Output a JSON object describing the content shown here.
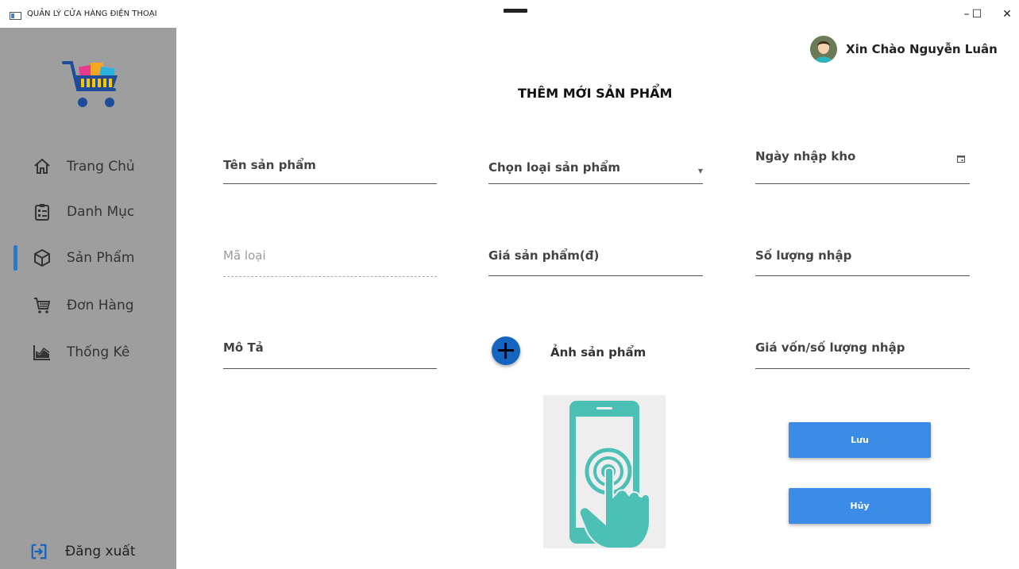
{
  "window": {
    "title": "QUẢN LÝ CỬA HÀNG ĐIỆN THOẠI",
    "minimize_glyph": "–",
    "maximize_glyph": "☐",
    "close_glyph": "✕"
  },
  "header": {
    "greeting": "Xin Chào Nguyễn Luân"
  },
  "sidebar": {
    "items": [
      {
        "label": "Trang Chủ",
        "icon": "home-icon"
      },
      {
        "label": "Danh Mục",
        "icon": "clipboard-list-icon"
      },
      {
        "label": "Sản Phẩm",
        "icon": "cube-icon",
        "active": true
      },
      {
        "label": "Đơn Hàng",
        "icon": "cart-icon"
      },
      {
        "label": "Thống Kê",
        "icon": "chart-area-icon"
      }
    ],
    "logout": "Đăng xuất"
  },
  "form": {
    "title": "THÊM MỚI SẢN PHẨM",
    "product_name": "Tên sản phẩm",
    "category": "Chọn loại sản phẩm",
    "import_date": "Ngày nhập kho",
    "category_code": "Mã loại",
    "price": "Giá sản phẩm(đ)",
    "quantity": "Số lượng nhập",
    "description": "Mô Tả",
    "image_label": "Ảnh sản phẩm",
    "cost": "Giá vốn/số lượng nhập",
    "save": "Lưu",
    "cancel": "Hủy"
  },
  "colors": {
    "sidebar_bg": "#9e9e9e",
    "accent": "#1e7be0",
    "button": "#3b8ce6",
    "phone_teal": "#4dc0b5"
  }
}
